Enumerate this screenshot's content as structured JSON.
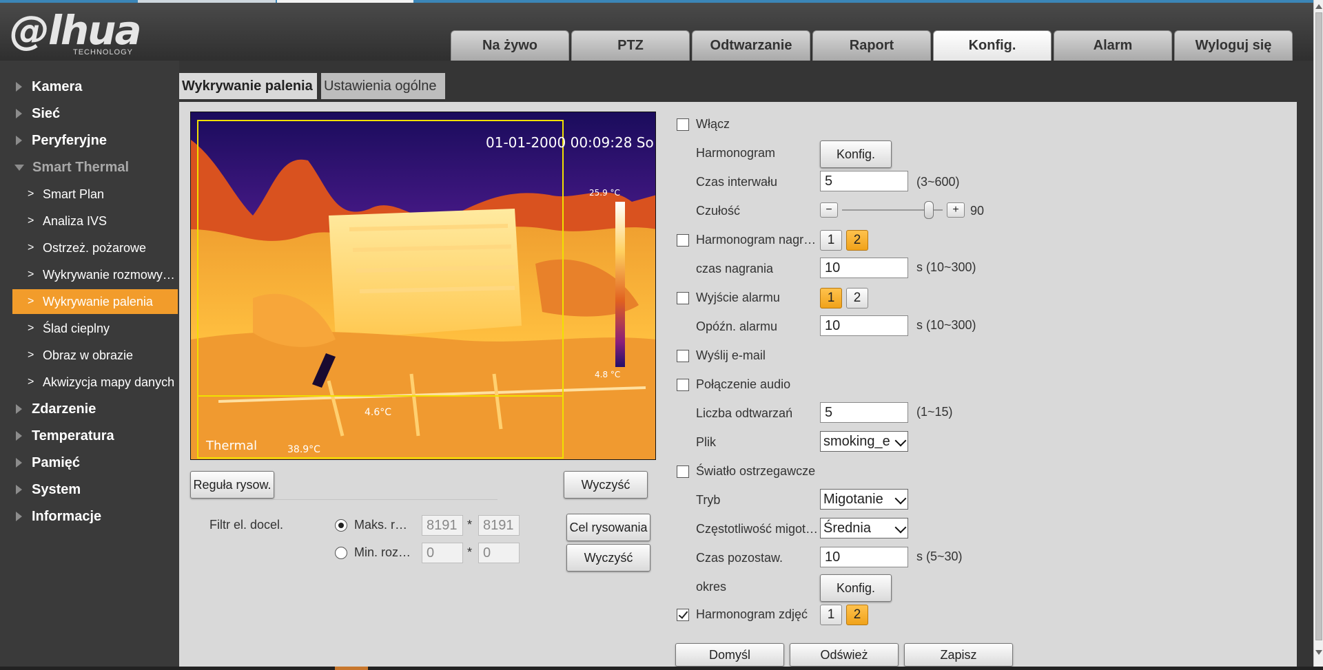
{
  "header": {
    "brand": "@lhua",
    "brand_sub": "TECHNOLOGY",
    "tabs": [
      {
        "label": "Na żywo",
        "active": false
      },
      {
        "label": "PTZ",
        "active": false
      },
      {
        "label": "Odtwarzanie",
        "active": false
      },
      {
        "label": "Raport",
        "active": false
      },
      {
        "label": "Konfig.",
        "active": true
      },
      {
        "label": "Alarm",
        "active": false
      },
      {
        "label": "Wyloguj się",
        "active": false
      }
    ]
  },
  "sidebar": {
    "top": [
      "Kamera",
      "Sieć",
      "Peryferyjne",
      "Smart Thermal"
    ],
    "sub": [
      "Smart Plan",
      "Analiza IVS",
      "Ostrzeż. pożarowe",
      "Wykrywanie rozmowy…",
      "Wykrywanie palenia",
      "Ślad cieplny",
      "Obraz w obrazie",
      "Akwizycja mapy danych"
    ],
    "bottom": [
      "Zdarzenie",
      "Temperatura",
      "Pamięć",
      "System",
      "Informacje"
    ],
    "active_sub": "Wykrywanie palenia",
    "accent": "#f29c2b"
  },
  "subtabs": {
    "active": "Wykrywanie palenia",
    "other": "Ustawienia ogólne"
  },
  "video": {
    "timestamp": "01-01-2000 00:09:28 So",
    "channel": "Thermal",
    "scale_max": "25.9 °C",
    "scale_min": "4.8 °C",
    "spot1": "4.6°C",
    "spot2": "38.9°C"
  },
  "left_controls": {
    "draw_rule": "Reguła rysow.",
    "clear": "Wyczyść",
    "filter_label": "Filtr el. docel.",
    "max_label": "Maks. r…",
    "min_label": "Min. roz…",
    "max_w": "8191",
    "max_h": "8191",
    "min_w": "0",
    "min_h": "0",
    "times": "*",
    "draw_target": "Cel rysowania",
    "clear2": "Wyczyść"
  },
  "settings": {
    "enable": {
      "label": "Włącz",
      "checked": false
    },
    "schedule": {
      "label": "Harmonogram",
      "button": "Konfig."
    },
    "interval": {
      "label": "Czas interwału",
      "value": "5",
      "range": "(3~600)"
    },
    "sensitivity": {
      "label": "Czułość",
      "value": "90",
      "fraction": 0.9
    },
    "record_schedule": {
      "label": "Harmonogram nagr…",
      "checked": false,
      "options": [
        "1",
        "2"
      ]
    },
    "record_time": {
      "label": "czas nagrania",
      "value": "10",
      "range": "s (10~300)"
    },
    "alarm_output": {
      "label": "Wyjście alarmu",
      "checked": false,
      "options": [
        "1",
        "2"
      ]
    },
    "alarm_delay": {
      "label": "Opóźn. alarmu",
      "value": "10",
      "range": "s (10~300)"
    },
    "send_email": {
      "label": "Wyślij e-mail",
      "checked": false
    },
    "audio": {
      "label": "Połączenie audio",
      "checked": false
    },
    "play_count": {
      "label": "Liczba odtwarzań",
      "value": "5",
      "range": "(1~15)"
    },
    "file": {
      "label": "Plik",
      "value": "smoking_e"
    },
    "warning_light": {
      "label": "Światło ostrzegawcze",
      "checked": false
    },
    "mode": {
      "label": "Tryb",
      "value": "Migotanie"
    },
    "blink_freq": {
      "label": "Częstotliwość migot…",
      "value": "Średnia"
    },
    "hold_time": {
      "label": "Czas pozostaw.",
      "value": "10",
      "range": "s (5~30)"
    },
    "period": {
      "label": "okres",
      "button": "Konfig."
    },
    "snapshot_schedule": {
      "label": "Harmonogram zdjęć",
      "checked": true,
      "options": [
        "1",
        "2"
      ]
    }
  },
  "footer_buttons": {
    "default": "Domyśl",
    "refresh": "Odśwież",
    "save": "Zapisz"
  }
}
